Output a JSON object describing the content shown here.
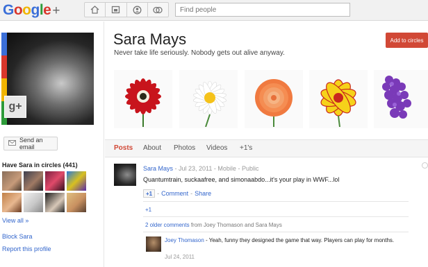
{
  "header": {
    "logo_letters": [
      "G",
      "o",
      "o",
      "g",
      "l",
      "e"
    ],
    "logo_plus": "+",
    "nav_icons": [
      "home-icon",
      "photos-icon",
      "profile-icon",
      "circles-icon"
    ],
    "search_placeholder": "Find people"
  },
  "profile": {
    "name": "Sara Mays",
    "tagline": "Never take life seriously. Nobody gets out alive anyway.",
    "add_button": "Add to circles",
    "gplus_badge": "g+"
  },
  "sidebar": {
    "send_email": "Send an email",
    "circles_title": "Have Sara in circles (441)",
    "view_all": "View all »",
    "block": "Block Sara",
    "report": "Report this profile"
  },
  "photos": [
    "red-flower",
    "white-daisy",
    "orange-rose",
    "yellow-flower",
    "purple-hyacinth"
  ],
  "tabs": [
    "Posts",
    "About",
    "Photos",
    "Videos",
    "+1's"
  ],
  "active_tab": "Posts",
  "post": {
    "author": "Sara Mays",
    "date": "Jul 23, 2011",
    "via": "Mobile",
    "visibility": "Public",
    "text": "Quantumtrain, suckaafree, and simonaabdo...it's your play in WWF...lol",
    "g1_label": "+1",
    "comment_label": "Comment",
    "share_label": "Share",
    "plus_one_count": "+1",
    "older_comments_link": "2 older comments",
    "older_comments_rest": "from Joey Thomason and Sara Mays"
  },
  "comment": {
    "author": "Joey Thomason",
    "text": " - Yeah, funny they designed the game that way. Players can play for months.",
    "date": "Jul 24, 2011"
  },
  "colors": {
    "accent_red": "#d14836",
    "link_blue": "#3366cc",
    "topbar_bg": "#f1f1f1"
  }
}
